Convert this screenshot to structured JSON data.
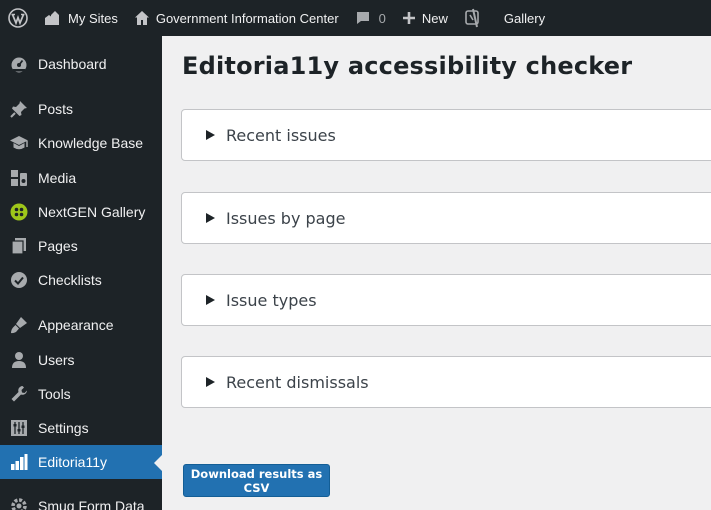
{
  "admin_bar": {
    "my_sites": "My Sites",
    "site_name": "Government Information Center",
    "comments_count": "0",
    "new_label": "New",
    "gallery_label": "Gallery"
  },
  "sidebar": {
    "items": [
      {
        "label": "Dashboard",
        "icon": "dashboard-icon"
      },
      {
        "label": "Posts",
        "icon": "pin-icon"
      },
      {
        "label": "Knowledge Base",
        "icon": "graduation-cap-icon"
      },
      {
        "label": "Media",
        "icon": "media-icon"
      },
      {
        "label": "NextGEN Gallery",
        "icon": "nextgen-icon"
      },
      {
        "label": "Pages",
        "icon": "pages-icon"
      },
      {
        "label": "Checklists",
        "icon": "check-circle-icon"
      },
      {
        "label": "Appearance",
        "icon": "brush-icon"
      },
      {
        "label": "Users",
        "icon": "users-icon"
      },
      {
        "label": "Tools",
        "icon": "wrench-icon"
      },
      {
        "label": "Settings",
        "icon": "settings-sliders-icon"
      },
      {
        "label": "Editoria11y",
        "icon": "bar-chart-icon",
        "current": true
      },
      {
        "label": "Smug Form Data",
        "icon": "gear-icon"
      }
    ]
  },
  "main": {
    "title": "Editoria11y accessibility checker",
    "panels": [
      "Recent issues",
      "Issues by page",
      "Issue types",
      "Recent dismissals"
    ],
    "download_button": "Download results as CSV"
  },
  "colors": {
    "admin_bg": "#1d2327",
    "accent": "#2271b1",
    "content_bg": "#f0f0f1"
  }
}
